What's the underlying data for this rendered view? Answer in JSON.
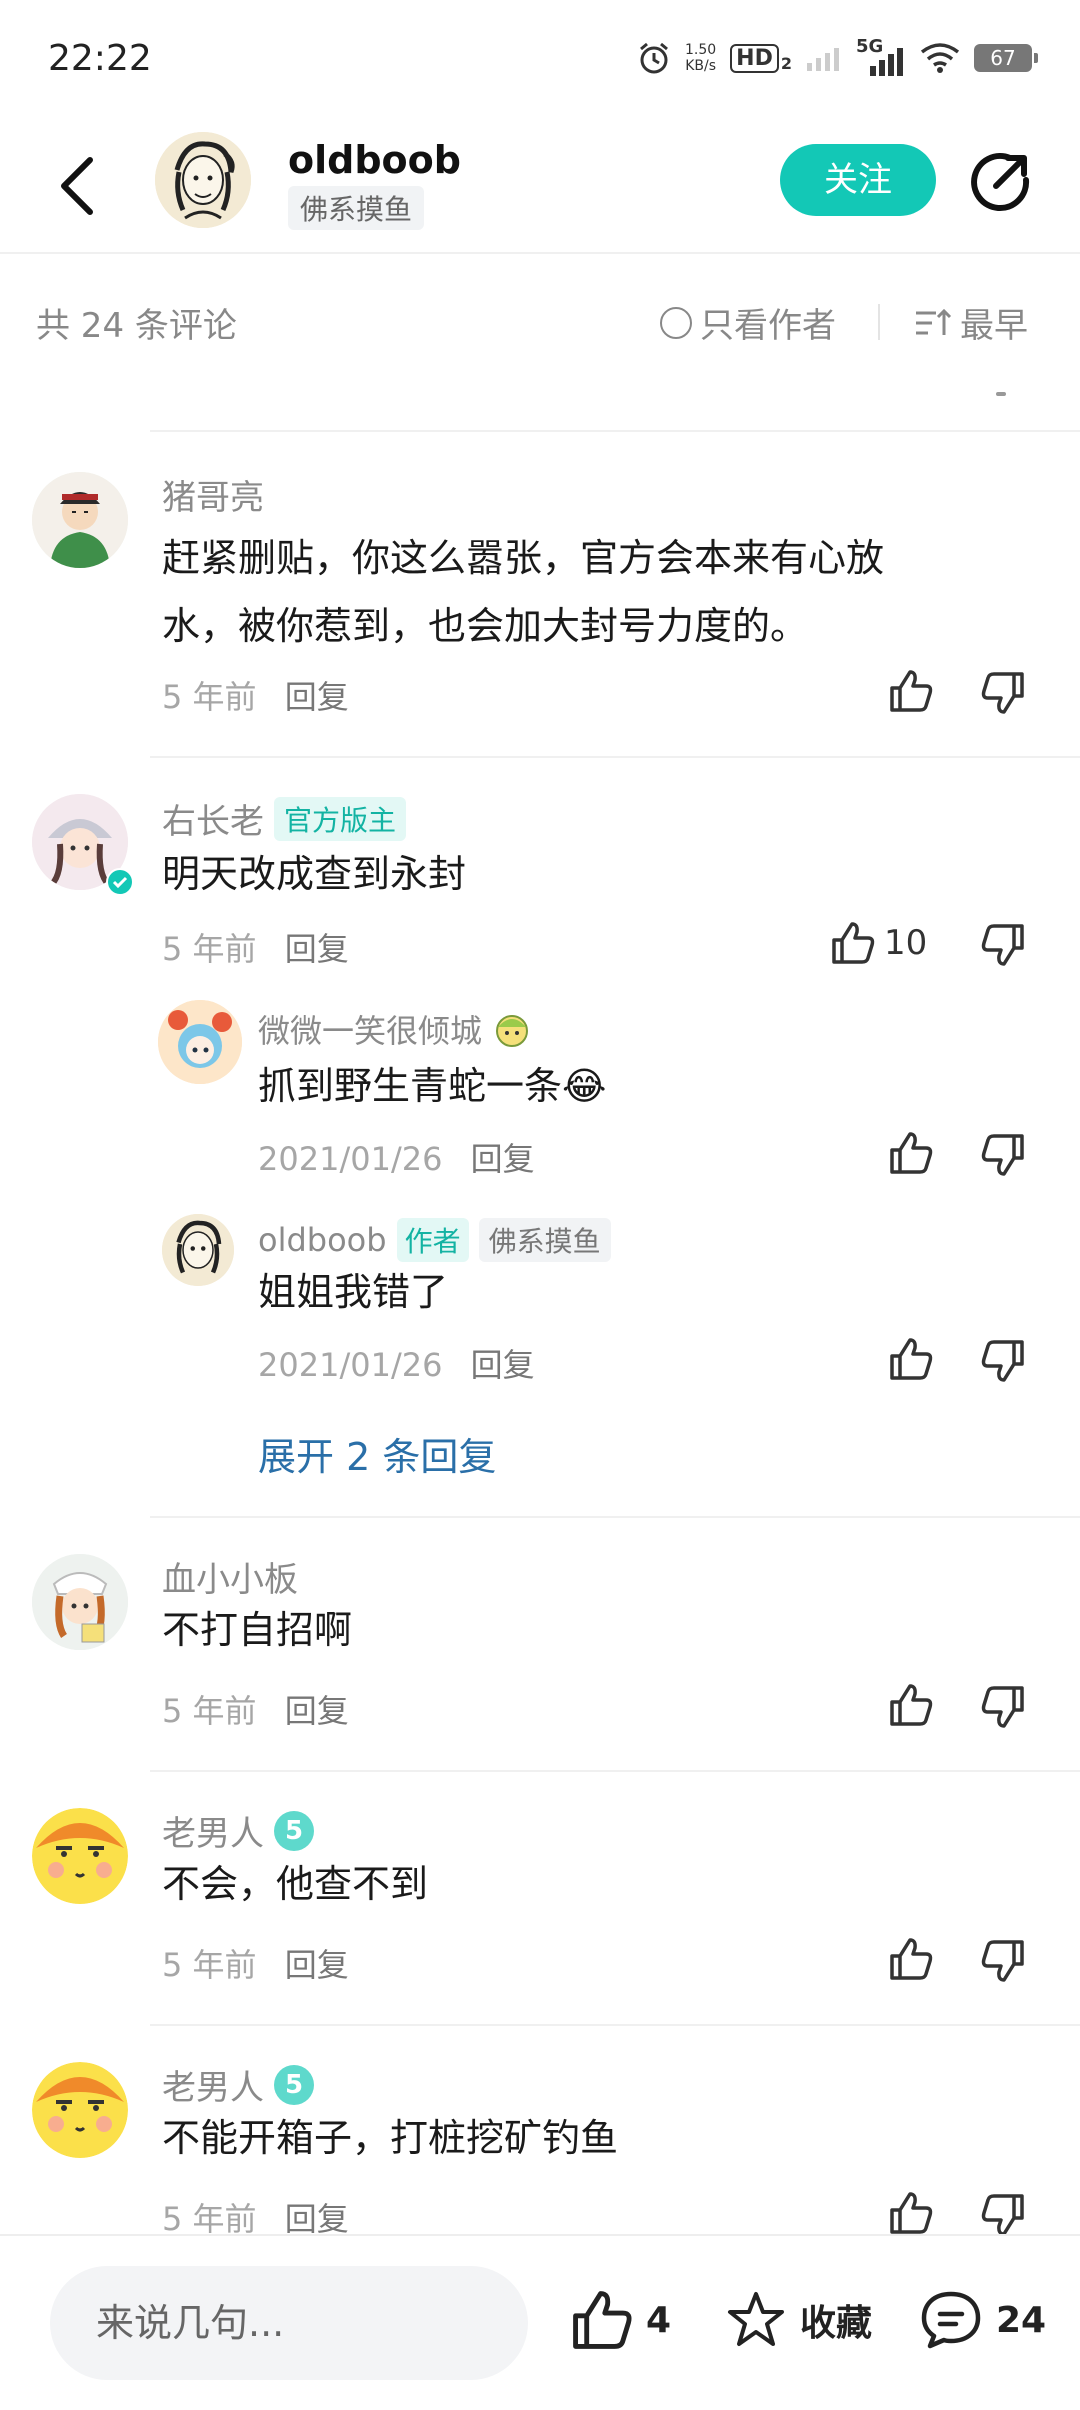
{
  "status_bar": {
    "time": "22:22",
    "net_speed_value": "1.50",
    "net_speed_unit": "KB/s",
    "hd": "HD",
    "hd_sub": "2",
    "five_g": "5G",
    "battery": "67"
  },
  "header": {
    "username": "oldboob",
    "tag": "佛系摸鱼",
    "follow_label": "关注"
  },
  "filter": {
    "count_label": "共 24 条评论",
    "author_only_label": "只看作者",
    "sort_label": "最早"
  },
  "comments": [
    {
      "user": "猪哥亮",
      "text_line1": "赶紧删贴，你这么嚣张，官方会本来有心放",
      "text_line2": "水，被你惹到，也会加大封号力度的。",
      "time": "5 年前",
      "reply": "回复"
    },
    {
      "user": "右长老",
      "badge": "官方版主",
      "text": "明天改成查到永封",
      "time": "5 年前",
      "reply": "回复",
      "likes": "10",
      "replies": [
        {
          "user": "微微一笑很倾城",
          "text": "抓到野生青蛇一条😂",
          "time": "2021/01/26",
          "reply": "回复"
        },
        {
          "user": "oldboob",
          "badge": "作者",
          "tag": "佛系摸鱼",
          "text": "姐姐我错了",
          "time": "2021/01/26",
          "reply": "回复"
        }
      ],
      "expand_label": "展开 2 条回复"
    },
    {
      "user": "血小小板",
      "text": "不打自招啊",
      "time": "5 年前",
      "reply": "回复"
    },
    {
      "user": "老男人",
      "level": "5",
      "text": "不会，他查不到",
      "time": "5 年前",
      "reply": "回复"
    },
    {
      "user": "老男人",
      "level": "5",
      "text": "不能开箱子，打桩挖矿钓鱼",
      "time": "5 年前",
      "reply": "回复"
    }
  ],
  "bottom_bar": {
    "input_placeholder": "来说几句...",
    "like_count": "4",
    "collect_label": "收藏",
    "comment_count": "24"
  },
  "colors": {
    "accent": "#13c8b6",
    "link": "#2a6fa8",
    "muted": "#8a8a8a"
  }
}
